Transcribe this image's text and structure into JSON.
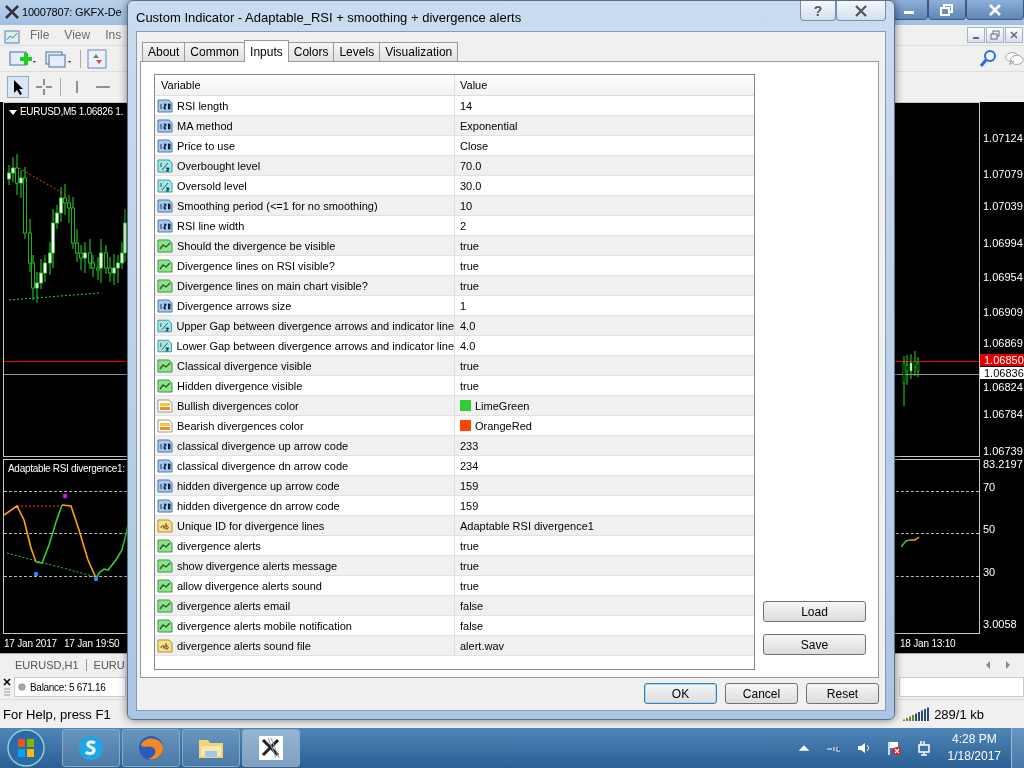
{
  "app_window": {
    "title": "10007807: GKFX-De",
    "menu": [
      "File",
      "View",
      "Ins"
    ]
  },
  "chart": {
    "title": "EURUSD,M5  1.06826 1.",
    "price_labels": [
      "1.07124",
      "1.07079",
      "1.07039",
      "1.06994",
      "1.06954",
      "1.06909",
      "1.06869",
      "1.06824",
      "1.06784",
      "1.06739"
    ],
    "bid_label": "1.06850",
    "ask_label": "1.06836",
    "indicator_title": "Adaptable RSI divergence1:",
    "indicator_labels": [
      "83.2197",
      "70",
      "50",
      "30",
      "3.0058"
    ],
    "time_labels": [
      "17 Jan 2017",
      "17 Jan 19:50",
      "18 Jan 13:10"
    ]
  },
  "chart_tabs": [
    "EURUSD,H1",
    "EURU"
  ],
  "terminal": {
    "balance": "Balance: 5 671.16"
  },
  "status_bar": {
    "help": "For Help, press F1",
    "traffic": "289/1 kb"
  },
  "dialog": {
    "title": "Custom Indicator - Adaptable_RSI + smoothing + divergence alerts",
    "help_button": "?",
    "tabs": [
      {
        "label": "About",
        "selected": false
      },
      {
        "label": "Common",
        "selected": false
      },
      {
        "label": "Inputs",
        "selected": true
      },
      {
        "label": "Colors",
        "selected": false
      },
      {
        "label": "Levels",
        "selected": false
      },
      {
        "label": "Visualization",
        "selected": false
      }
    ],
    "columns": [
      "Variable",
      "Value"
    ],
    "rows": [
      {
        "kind": "int",
        "variable": "RSI length",
        "value": "14"
      },
      {
        "kind": "int",
        "variable": "MA method",
        "value": "Exponential"
      },
      {
        "kind": "int",
        "variable": "Price to use",
        "value": "Close"
      },
      {
        "kind": "double",
        "variable": "Overbought level",
        "value": "70.0"
      },
      {
        "kind": "double",
        "variable": "Oversold level",
        "value": "30.0"
      },
      {
        "kind": "int",
        "variable": "Smoothing period (<=1 for no smoothing)",
        "value": "10"
      },
      {
        "kind": "int",
        "variable": "RSI line width",
        "value": "2"
      },
      {
        "kind": "bool",
        "variable": "Should the divergence be visible",
        "value": "true"
      },
      {
        "kind": "bool",
        "variable": "Divergence lines on RSI visible?",
        "value": "true"
      },
      {
        "kind": "bool",
        "variable": "Divergence lines on main chart visible?",
        "value": "true"
      },
      {
        "kind": "int",
        "variable": "Divergence arrows size",
        "value": "1"
      },
      {
        "kind": "double",
        "variable": "Upper Gap between divergence arrows and indicator line",
        "value": "4.0"
      },
      {
        "kind": "double",
        "variable": "Lower Gap between divergence arrows and indicator line",
        "value": "4.0"
      },
      {
        "kind": "bool",
        "variable": "Classical divergence visible",
        "value": "true"
      },
      {
        "kind": "bool",
        "variable": "Hidden divergence visible",
        "value": "true"
      },
      {
        "kind": "color",
        "variable": "Bullish divergences color",
        "value": "LimeGreen",
        "color": "#32cd32"
      },
      {
        "kind": "color",
        "variable": "Bearish divergences color",
        "value": "OrangeRed",
        "color": "#ff4500"
      },
      {
        "kind": "int",
        "variable": "classical divergence up arrow code",
        "value": "233"
      },
      {
        "kind": "int",
        "variable": "classical divergence dn arrow code",
        "value": "234"
      },
      {
        "kind": "int",
        "variable": "hidden divergence up arrow code",
        "value": "159"
      },
      {
        "kind": "int",
        "variable": "hidden divergence dn arrow code",
        "value": "159"
      },
      {
        "kind": "string",
        "variable": "Unique ID for divergence lines",
        "value": "Adaptable RSI divergence1"
      },
      {
        "kind": "bool",
        "variable": "divergence alerts",
        "value": "true"
      },
      {
        "kind": "bool",
        "variable": "show divergence alerts message",
        "value": "true"
      },
      {
        "kind": "bool",
        "variable": "allow divergence alerts sound",
        "value": "true"
      },
      {
        "kind": "bool",
        "variable": "divergence alerts email",
        "value": "false"
      },
      {
        "kind": "bool",
        "variable": "divergence alerts mobile notification",
        "value": "false"
      },
      {
        "kind": "string",
        "variable": "divergence alerts sound file",
        "value": "alert.wav"
      }
    ],
    "side_buttons": [
      "Load",
      "Save"
    ],
    "buttons": [
      {
        "label": "OK",
        "selected": true
      },
      {
        "label": "Cancel",
        "selected": false
      },
      {
        "label": "Reset",
        "selected": false
      }
    ]
  },
  "taskbar": {
    "time": "4:28 PM",
    "date": "1/18/2017"
  }
}
